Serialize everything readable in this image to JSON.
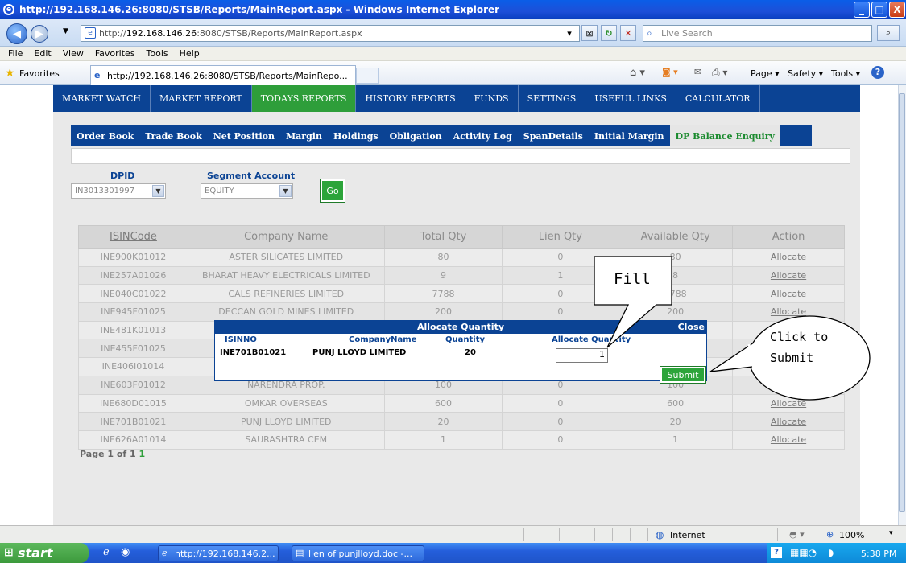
{
  "window": {
    "title": "http://192.168.146.26:8080/STSB/Reports/MainReport.aspx - Windows Internet Explorer",
    "minimize": "_",
    "maximize": "□",
    "close": "X"
  },
  "address_bar": {
    "url_prefix": "http://",
    "url_host": "192.168.146.26",
    "url_rest": ":8080/STSB/Reports/MainReport.aspx",
    "search_placeholder": "Live Search"
  },
  "menu": [
    "File",
    "Edit",
    "View",
    "Favorites",
    "Tools",
    "Help"
  ],
  "favorites_bar": {
    "favorites_label": "Favorites",
    "tab_title": "http://192.168.146.26:8080/STSB/Reports/MainRepo...",
    "tools": [
      "Page ▾",
      "Safety ▾",
      "Tools ▾"
    ]
  },
  "main_nav": [
    {
      "label": "MARKET WATCH",
      "active": false
    },
    {
      "label": "MARKET REPORT",
      "active": false
    },
    {
      "label": "TODAYS REPORTS",
      "active": true
    },
    {
      "label": "HISTORY REPORTS",
      "active": false
    },
    {
      "label": "FUNDS",
      "active": false
    },
    {
      "label": "SETTINGS",
      "active": false
    },
    {
      "label": "USEFUL LINKS",
      "active": false
    },
    {
      "label": "CALCULATOR",
      "active": false
    }
  ],
  "sub_nav": [
    {
      "label": "Order Book",
      "active": false
    },
    {
      "label": "Trade Book",
      "active": false
    },
    {
      "label": "Net Position",
      "active": false
    },
    {
      "label": "Margin",
      "active": false
    },
    {
      "label": "Holdings",
      "active": false
    },
    {
      "label": "Obligation",
      "active": false
    },
    {
      "label": "Activity Log",
      "active": false
    },
    {
      "label": "SpanDetails",
      "active": false
    },
    {
      "label": "Initial Margin",
      "active": false
    },
    {
      "label": "DP Balance Enquiry",
      "active": true
    }
  ],
  "filters": {
    "dpid_label": "DPID",
    "dpid_value": "IN3013301997",
    "segment_label": "Segment Account",
    "segment_value": "EQUITY",
    "go_label": "Go"
  },
  "table": {
    "headers": [
      "ISINCode",
      "Company Name",
      "Total Qty",
      "Lien Qty",
      "Available Qty",
      "Action"
    ],
    "rows": [
      [
        "INE900K01012",
        "ASTER SILICATES LIMITED",
        "80",
        "0",
        "80",
        "Allocate"
      ],
      [
        "INE257A01026",
        "BHARAT HEAVY ELECTRICALS LIMITED",
        "9",
        "1",
        "8",
        "Allocate"
      ],
      [
        "INE040C01022",
        "CALS REFINERIES LIMITED",
        "7788",
        "0",
        "7788",
        "Allocate"
      ],
      [
        "INE945F01025",
        "DECCAN GOLD MINES LIMITED",
        "200",
        "0",
        "200",
        "Allocate"
      ],
      [
        "INE481K01013",
        "",
        "",
        "",
        "",
        ""
      ],
      [
        "INE455F01025",
        "",
        "",
        "",
        "",
        ""
      ],
      [
        "INE406I01014",
        "",
        "",
        "",
        "",
        ""
      ],
      [
        "INE603F01012",
        "NARENDRA PROP.",
        "100",
        "0",
        "100",
        "Allocate"
      ],
      [
        "INE680D01015",
        "OMKAR OVERSEAS",
        "600",
        "0",
        "600",
        "Allocate"
      ],
      [
        "INE701B01021",
        "PUNJ LLOYD LIMITED",
        "20",
        "0",
        "20",
        "Allocate"
      ],
      [
        "INE626A01014",
        "SAURASHTRA CEM",
        "1",
        "0",
        "1",
        "Allocate"
      ]
    ]
  },
  "pager": {
    "text": "Page 1 of 1",
    "current": "1"
  },
  "popup": {
    "title": "Allocate Quantity",
    "close_label": "Close",
    "col_isin": "ISINNO",
    "col_company": "CompanyName",
    "col_qty": "Quantity",
    "col_alloc": "Allocate Quantity",
    "isin": "INE701B01021",
    "company": "PUNJ LLOYD LIMITED",
    "quantity": "20",
    "alloc_value": "1",
    "submit_label": "Submit"
  },
  "callouts": {
    "fill": "Fill",
    "click_line1": "Click to",
    "click_line2": "Submit"
  },
  "status_bar": {
    "zone": "Internet",
    "zoom": "100%"
  },
  "taskbar": {
    "start": "start",
    "item1": "http://192.168.146.2...",
    "item2": "lien of punjlloyd.doc -...",
    "time": "5:38 PM"
  },
  "colors": {
    "nav_blue": "#0b4394",
    "active_green": "#2e9e3a"
  }
}
